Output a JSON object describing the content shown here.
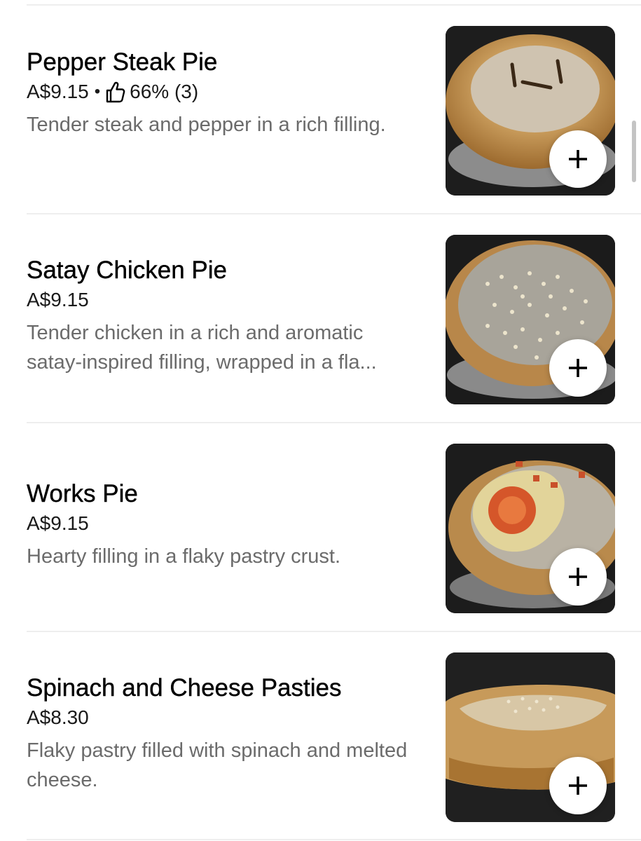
{
  "menu": {
    "items": [
      {
        "name": "Pepper Steak Pie",
        "price": "A$9.15",
        "separator": "•",
        "rating": "66% (3)",
        "description": "Tender steak and pepper in a rich filling.",
        "image_icon": "pie-photo",
        "add_icon": "plus-icon"
      },
      {
        "name": "Satay Chicken Pie",
        "price": "A$9.15",
        "description_line1": "Tender chicken in a rich and aromatic",
        "description_line2": "satay-inspired filling, wrapped in a fla...",
        "image_icon": "pie-photo",
        "add_icon": "plus-icon"
      },
      {
        "name": "Works Pie",
        "price": "A$9.15",
        "description": "Hearty filling in a flaky pastry crust.",
        "image_icon": "pie-photo",
        "add_icon": "plus-icon"
      },
      {
        "name": "Spinach and Cheese Pasties",
        "price": "A$8.30",
        "description": "Flaky pastry filled with spinach and melted cheese.",
        "image_icon": "pasty-photo",
        "add_icon": "plus-icon"
      }
    ]
  },
  "colors": {
    "title": "#000000",
    "description": "#6b6b6b",
    "divider": "#eeeeee",
    "add_button_bg": "#ffffff",
    "image_bg": "#1d1d1d"
  }
}
